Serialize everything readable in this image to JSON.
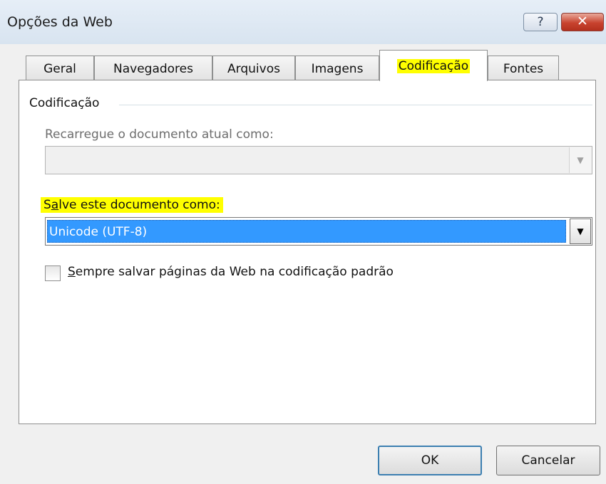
{
  "window": {
    "title": "Opções da Web",
    "help_glyph": "?",
    "close_glyph": "✕"
  },
  "tabs": [
    {
      "label": "Geral",
      "active": false
    },
    {
      "label": "Navegadores",
      "active": false
    },
    {
      "label": "Arquivos",
      "active": false
    },
    {
      "label": "Imagens",
      "active": false
    },
    {
      "label": "Codificação",
      "active": true
    },
    {
      "label": "Fontes",
      "active": false
    }
  ],
  "encoding": {
    "group_title": "Codificação",
    "reload_label": "Recarregue o documento atual como:",
    "reload_value": "",
    "save_label_prefix": "S",
    "save_label_accel": "a",
    "save_label_rest": "lve este documento como:",
    "save_value": "Unicode (UTF-8)",
    "always_save_accel": "S",
    "always_save_rest": "empre salvar páginas da Web na codificação padrão",
    "always_save_checked": false
  },
  "buttons": {
    "ok": "OK",
    "cancel": "Cancelar"
  },
  "colors": {
    "highlight": "#ffff00",
    "selection": "#3399ff",
    "close_button": "#c8432f"
  },
  "icons": {
    "dropdown": "▼",
    "dropdown_disabled": "▼"
  }
}
